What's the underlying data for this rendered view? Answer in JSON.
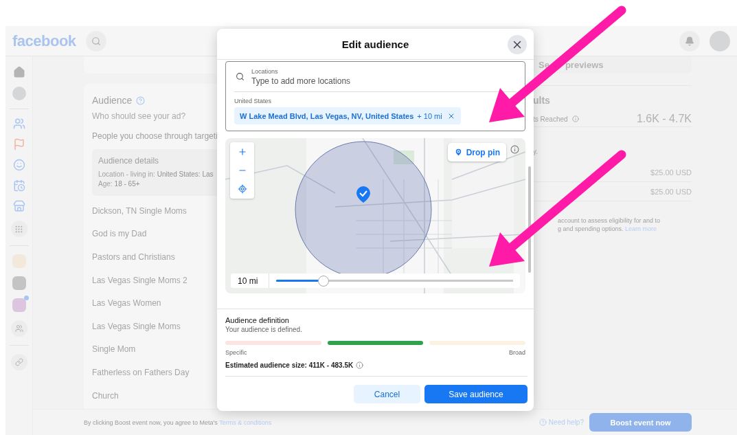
{
  "top_bar": {
    "logo": "facebook"
  },
  "audience_card": {
    "title": "Audience",
    "subtitle": "Who should see your ad?",
    "option": "People you choose through targeti",
    "details": {
      "title": "Audience details",
      "location_label": "Location - living in:",
      "location_value": "United States: Las",
      "age_label": "Age:",
      "age_value": "18 - 65+"
    },
    "saved_audiences": [
      "Dickson, TN Single Moms",
      "God is my Dad",
      "Pastors and Christians",
      "Las Vegas Single Moms 2",
      "Las Vegas Women",
      "Las Vegas Single Moms",
      "Single Mom",
      "Fatherless on Fathers Day",
      "Church"
    ]
  },
  "right_panel": {
    "previews": [
      "Se",
      "previews"
    ],
    "results_title": "ults",
    "reached_label": "ts Reached",
    "reached_value": "1.6K - 4.7K",
    "budget_note": "y.",
    "amounts": [
      "$25.00 USD",
      "$25.00 USD"
    ],
    "note_lines": [
      "account to assess eligibility for and to",
      "g and spending options."
    ],
    "learn_more": "Learn more"
  },
  "footer": {
    "agreement": "By clicking Boost event now, you agree to Meta's",
    "terms_link": "Terms & conditions",
    "help": "Need help?",
    "boost_button": "Boost event now"
  },
  "modal": {
    "title": "Edit audience",
    "locations": {
      "label": "Locations",
      "placeholder": "Type to add more locations",
      "country": "United States",
      "chip": {
        "place": "W Lake Mead Blvd, Las Vegas, NV, United States",
        "radius": "+ 10 mi"
      }
    },
    "map": {
      "drop_pin": "Drop pin",
      "slider": {
        "reading": "10 mi",
        "level": 0.2
      }
    },
    "definition": {
      "title": "Audience definition",
      "subtitle": "Your audience is defined.",
      "segments": [
        {
          "color": "#fbe4e4"
        },
        {
          "color": "#31a24c"
        },
        {
          "color": "#fcf2e2"
        }
      ],
      "left_label": "Specific",
      "right_label": "Broad",
      "estimate": "Estimated audience size: 411K - 483.5K"
    },
    "buttons": {
      "cancel": "Cancel",
      "save": "Save audience"
    }
  }
}
